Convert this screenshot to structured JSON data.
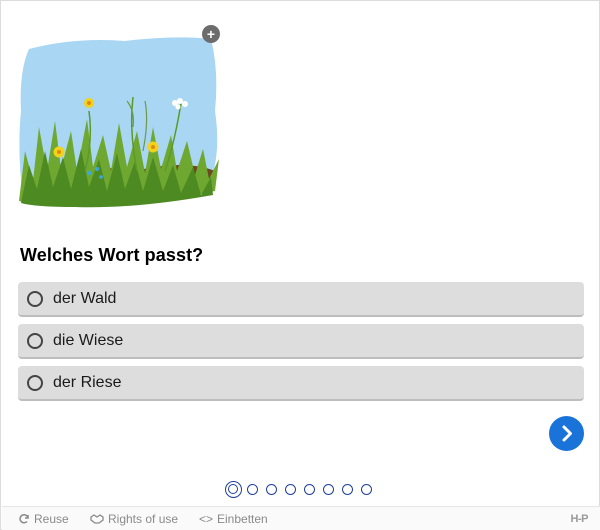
{
  "image": {
    "alt": "Wiese",
    "expand_icon": "plus-icon"
  },
  "question": {
    "text": "Welches Wort passt?"
  },
  "answers": [
    {
      "label": "der Wald",
      "selected": false
    },
    {
      "label": "die Wiese",
      "selected": false
    },
    {
      "label": "der Riese",
      "selected": false
    }
  ],
  "navigation": {
    "next_icon": "chevron-right-icon",
    "total_questions": 8,
    "current_index": 0
  },
  "footer": {
    "reuse_label": "Reuse",
    "rights_label": "Rights of use",
    "embed_label": "Einbetten",
    "brand": "H-P"
  },
  "colors": {
    "accent": "#1a73d9",
    "dot_border": "#1f3f9e",
    "answer_bg": "#dddddd",
    "footer_text": "#8a8a8a"
  }
}
